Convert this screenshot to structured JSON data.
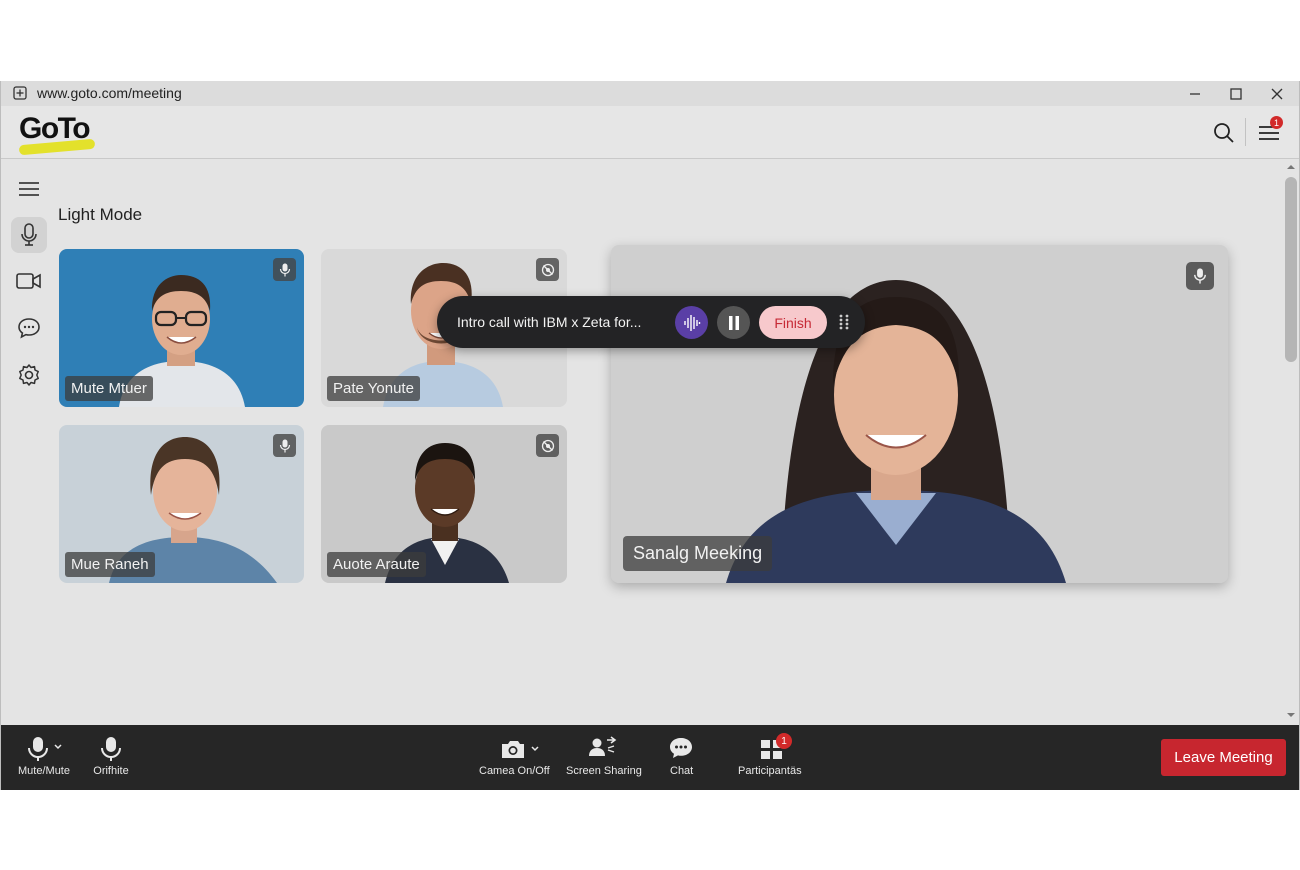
{
  "browser": {
    "url": "www.goto.com/meeting"
  },
  "header": {
    "logo_text": "GoTo",
    "menu_badge": "1"
  },
  "page": {
    "title": "Light Mode"
  },
  "participants": [
    {
      "name": "Mute Mtuer",
      "mic": "mic-icon",
      "bg": "#2f7fb6"
    },
    {
      "name": "Pate Yonute",
      "mic": "camera-off-icon",
      "bg": "#d9d9d9"
    },
    {
      "name": "Mue Raneh",
      "mic": "mic-icon",
      "bg": "#c8d1d8"
    },
    {
      "name": "Auote Araute",
      "mic": "camera-off-icon",
      "bg": "#c9c9c9"
    }
  ],
  "main_speaker": {
    "name": "Sanalg Meeking"
  },
  "recorder": {
    "title": "Intro call with IBM x Zeta for...",
    "finish_label": "Finish"
  },
  "toolbar": {
    "mute_label": "Mute/Mute",
    "mic_label": "Orifhite",
    "camera_label": "Camea On/Off",
    "screen_label": "Screen Sharing",
    "chat_label": "Chat",
    "participants_label": "Participantäs",
    "participants_badge": "1",
    "leave_label": "Leave Meeting"
  },
  "colors": {
    "leave": "#c7262f",
    "recorder_accent": "#5a3fa6",
    "finish_bg": "#f7c9cc"
  }
}
